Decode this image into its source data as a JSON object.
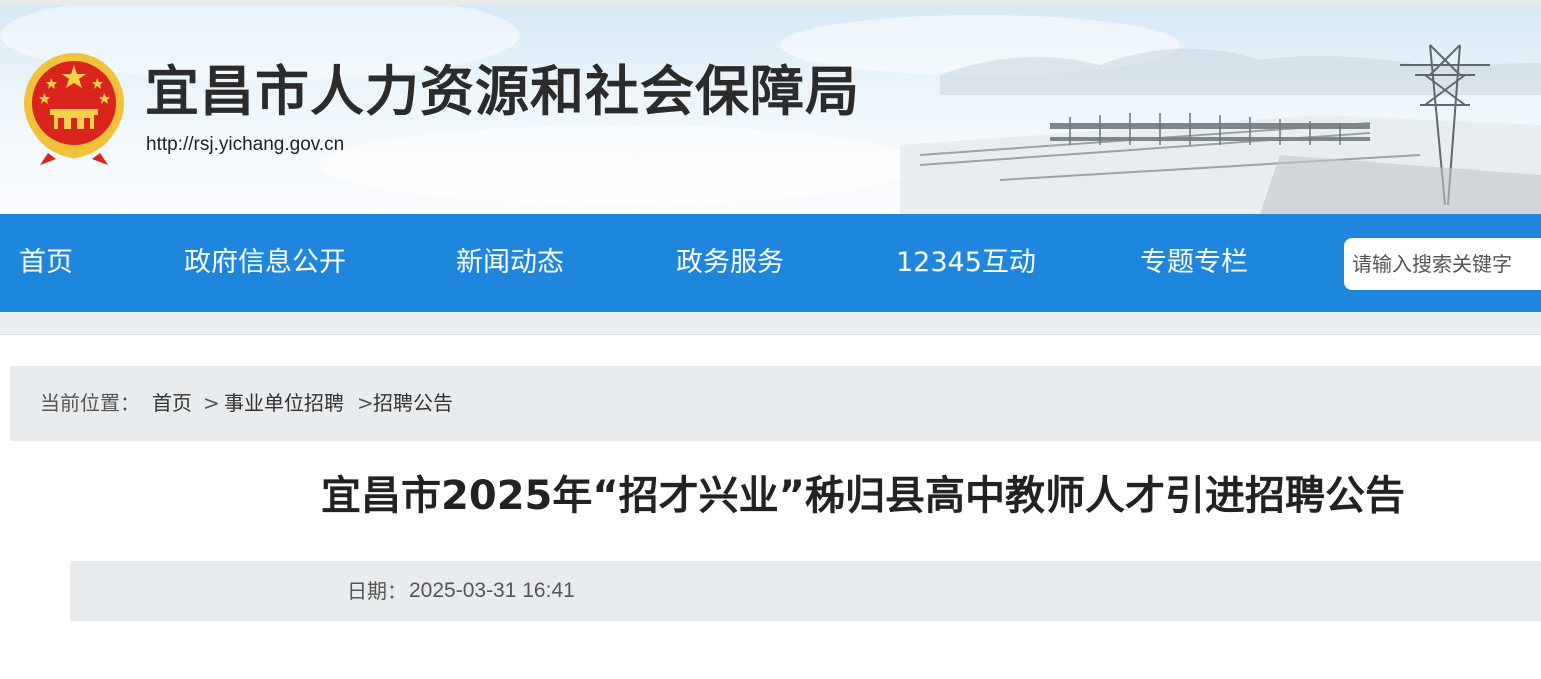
{
  "header": {
    "site_title": "宜昌市人力资源和社会保障局",
    "site_url": "http://rsj.yichang.gov.cn"
  },
  "nav": {
    "items": [
      {
        "label": "首页"
      },
      {
        "label": "政府信息公开"
      },
      {
        "label": "新闻动态"
      },
      {
        "label": "政务服务"
      },
      {
        "label": "12345互动"
      },
      {
        "label": "专题专栏"
      }
    ],
    "search_placeholder": "请输入搜索关键字"
  },
  "breadcrumb": {
    "label": "当前位置：",
    "items": [
      "首页",
      "事业单位招聘",
      "招聘公告"
    ],
    "separators": [
      ">",
      ">"
    ]
  },
  "article": {
    "title": "宜昌市2025年“招才兴业”秭归县高中教师人才引进招聘公告",
    "date_label": "日期：",
    "date": "2025-03-31 16:41"
  },
  "colors": {
    "nav_bg": "#1e87dd",
    "meta_bg": "#e9ecef"
  },
  "icons": [
    "national-emblem-icon"
  ]
}
